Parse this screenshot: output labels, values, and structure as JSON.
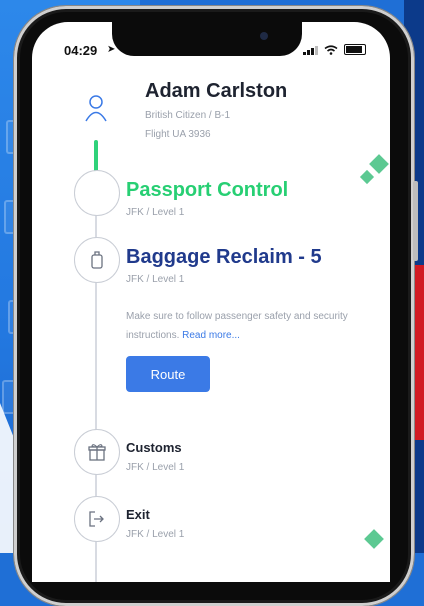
{
  "status_bar": {
    "time": "04:29"
  },
  "passenger": {
    "name": "Adam Carlston",
    "citizenship": "British Citizen / B-1",
    "flight": "Flight UA 3936"
  },
  "steps": [
    {
      "title": "Passport Control",
      "location": "JFK / Level 1"
    },
    {
      "title": "Baggage Reclaim - 5",
      "location": "JFK / Level 1",
      "description": "Make sure to follow passenger safety and security instructions.",
      "read_more": "Read more...",
      "button_label": "Route"
    },
    {
      "title": "Customs",
      "location": "JFK / Level 1"
    },
    {
      "title": "Exit",
      "location": "JFK / Level 1"
    }
  ],
  "colors": {
    "active_green": "#27cf73",
    "title_navy": "#203a8c",
    "accent_blue": "#3b7ae6",
    "muted_text": "#9aa0ab"
  }
}
